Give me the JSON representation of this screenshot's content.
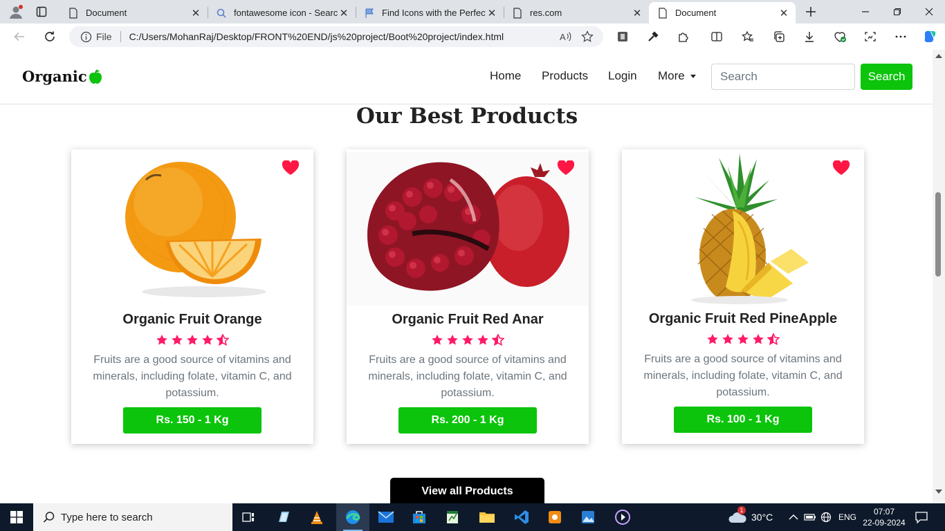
{
  "browser": {
    "tabs": [
      {
        "title": "Document",
        "icon": "page-icon",
        "active": false
      },
      {
        "title": "fontawesome icon - Search",
        "icon": "search-icon",
        "active": false
      },
      {
        "title": "Find Icons with the Perfect Lo",
        "icon": "flag-icon",
        "active": false
      },
      {
        "title": "res.com",
        "icon": "page-icon",
        "active": false
      },
      {
        "title": "Document",
        "icon": "page-icon",
        "active": true
      }
    ],
    "address": {
      "scheme_label": "File",
      "url": "C:/Users/MohanRaj/Desktop/FRONT%20END/js%20project/Boot%20project/index.html"
    }
  },
  "page": {
    "brand": "Organic",
    "nav": {
      "home": "Home",
      "products": "Products",
      "login": "Login",
      "more": "More"
    },
    "search": {
      "placeholder": "Search",
      "button": "Search"
    },
    "section_title": "Our Best Products",
    "products": [
      {
        "title": "Organic Fruit Orange",
        "rating": 4.5,
        "description": "Fruits are a good source of vitamins and minerals, including folate, vitamin C, and potassium.",
        "price": "Rs. 150 - 1 Kg"
      },
      {
        "title": "Organic Fruit Red Anar",
        "rating": 4.5,
        "description": "Fruits are a good source of vitamins and minerals, including folate, vitamin C, and potassium.",
        "price": "Rs. 200 - 1 Kg"
      },
      {
        "title": "Organic Fruit Red PineApple",
        "rating": 4.5,
        "description": "Fruits are a good source of vitamins and minerals, including folate, vitamin C, and potassium.",
        "price": "Rs. 100 - 1 Kg"
      }
    ],
    "view_all": "View all Products"
  },
  "taskbar": {
    "search_placeholder": "Type here to search",
    "weather": "30°C",
    "weather_badge": "1",
    "language": "ENG",
    "time": "07:07",
    "date": "22-09-2024"
  },
  "colors": {
    "brand_green": "#0bc40b",
    "star_pink": "#ff1a66",
    "heart_red": "#ff1744"
  }
}
